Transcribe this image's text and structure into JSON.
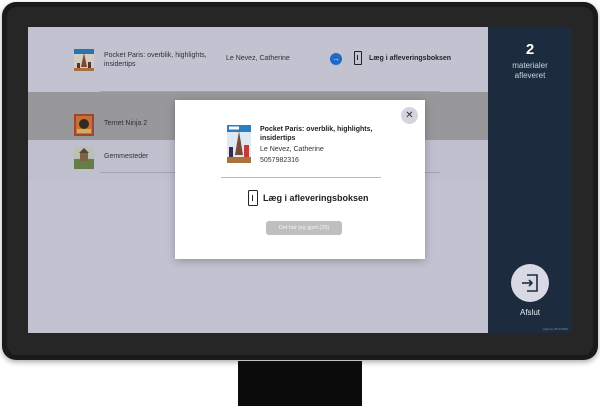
{
  "list": {
    "items": [
      {
        "title": "Pocket Paris: overblik, highlights, insidertips",
        "author": "Le Nevez, Catherine",
        "action_label": "Læg i afleveringsboksen"
      },
      {
        "title": "Ternet Ninja 2"
      },
      {
        "title": "Gemmesteder"
      }
    ]
  },
  "sidebar": {
    "count": "2",
    "count_label_line1": "materialer",
    "count_label_line2": "afleveret",
    "exit_label": "Afslut",
    "footer_tag": "Vejlevej 2019 0810"
  },
  "modal": {
    "title": "Pocket Paris: overblik, highlights, insidertips",
    "author": "Le Nevez, Catherine",
    "id": "5057982316",
    "instruction": "Læg i afleveringsboksen",
    "done_button": "Det har jeg gjort (29)",
    "close_glyph": "✕"
  },
  "icons": {
    "arrow": "arrow-right-icon",
    "box": "drop-box-icon",
    "exit": "exit-icon",
    "close": "close-icon"
  },
  "colors": {
    "sidebar_bg": "#1c2b3e",
    "accent_blue": "#1e72d8",
    "button_disabled": "#bfbfbf"
  }
}
